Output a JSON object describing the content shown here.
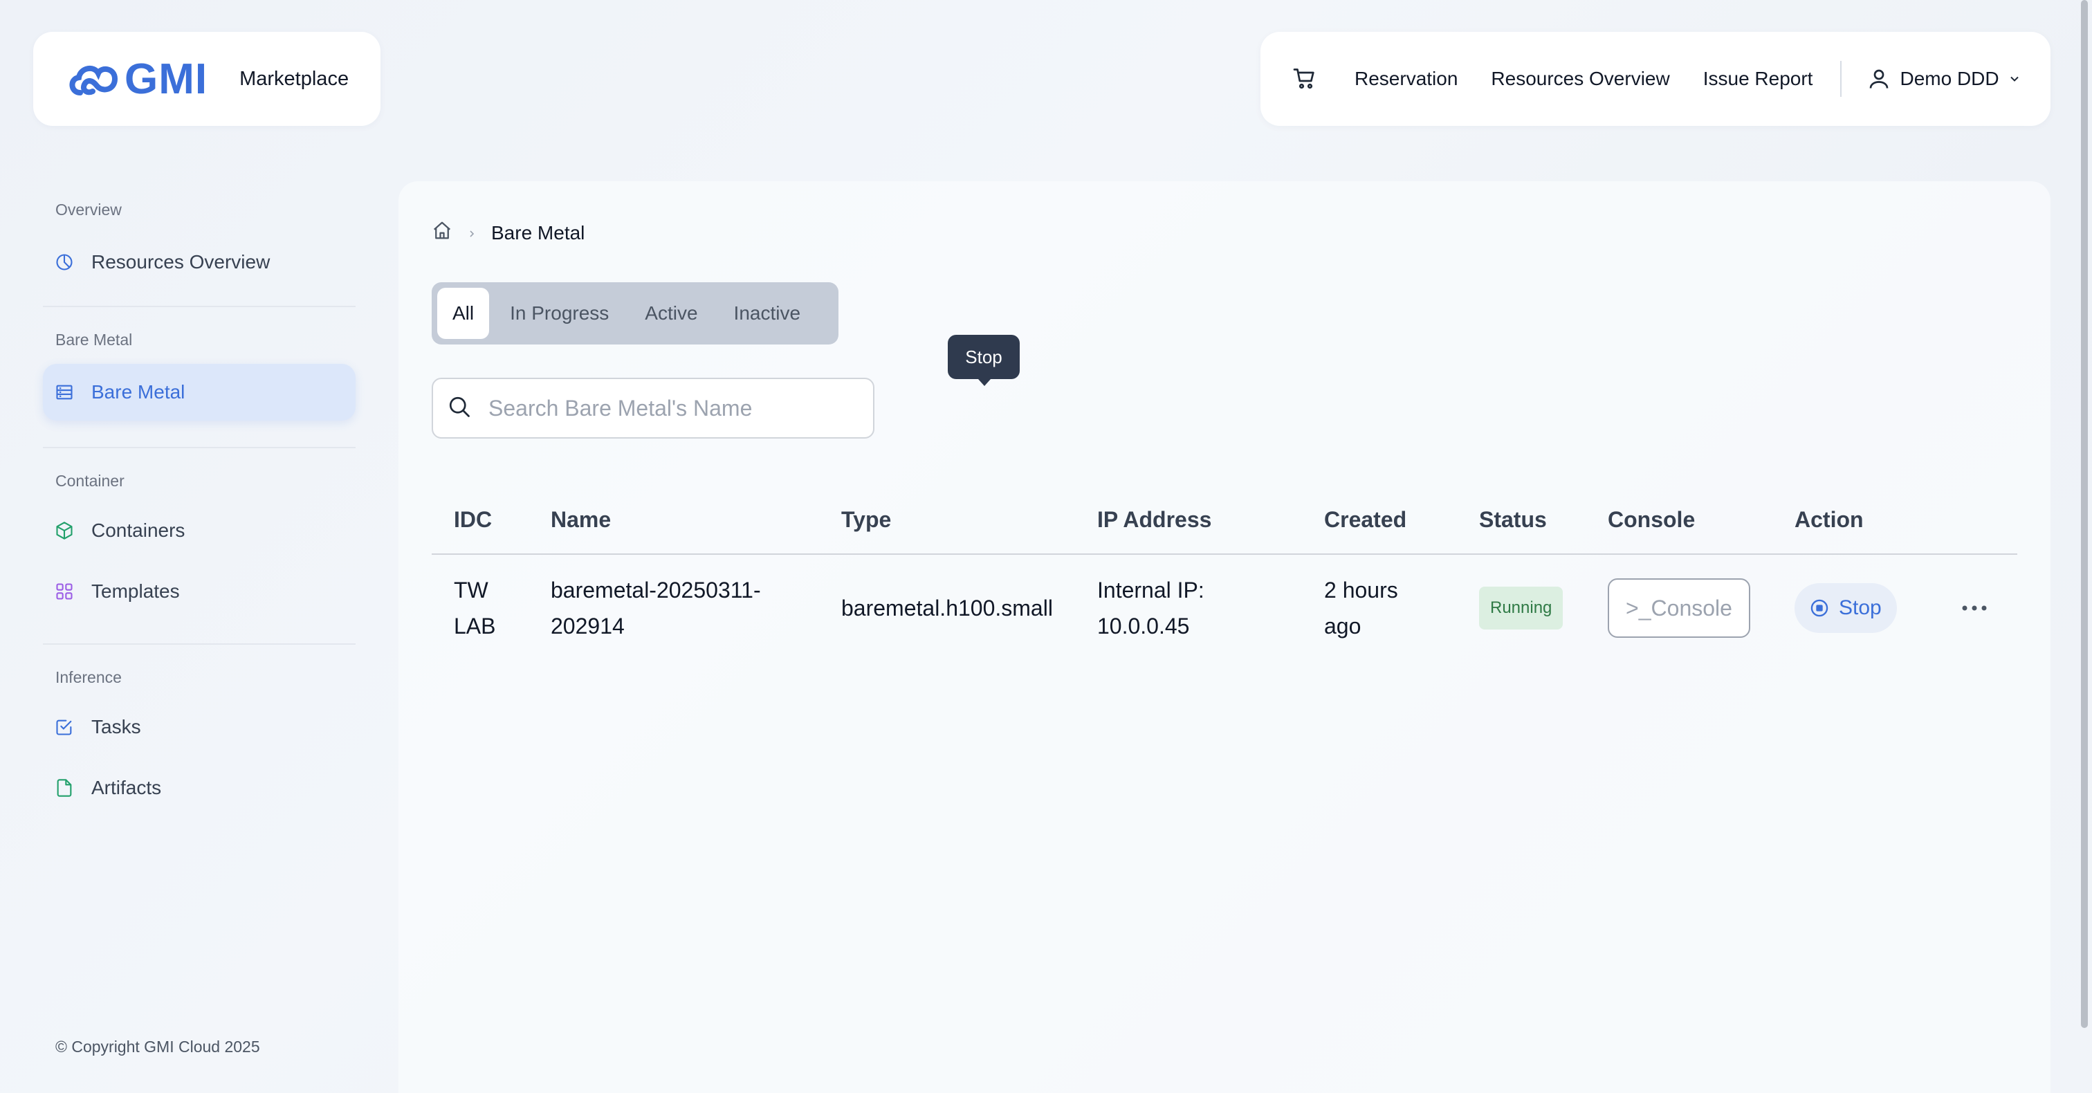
{
  "brand": {
    "name": "GMI",
    "marketplace_label": "Marketplace"
  },
  "nav": {
    "links": [
      "Reservation",
      "Resources Overview",
      "Issue Report"
    ],
    "user_name": "Demo DDD"
  },
  "sidebar": {
    "sections": [
      {
        "title": "Overview",
        "items": [
          {
            "label": "Resources Overview",
            "icon": "pie-chart-icon"
          }
        ]
      },
      {
        "title": "Bare Metal",
        "items": [
          {
            "label": "Bare Metal",
            "icon": "server-icon",
            "active": true
          }
        ]
      },
      {
        "title": "Container",
        "items": [
          {
            "label": "Containers",
            "icon": "cube-icon"
          },
          {
            "label": "Templates",
            "icon": "grid-icon"
          }
        ]
      },
      {
        "title": "Inference",
        "items": [
          {
            "label": "Tasks",
            "icon": "checkbox-icon"
          },
          {
            "label": "Artifacts",
            "icon": "file-icon"
          }
        ]
      }
    ],
    "copyright": "© Copyright GMI Cloud 2025"
  },
  "breadcrumb": {
    "current": "Bare Metal"
  },
  "tabs": [
    "All",
    "In Progress",
    "Active",
    "Inactive"
  ],
  "search": {
    "placeholder": "Search Bare Metal's Name",
    "value": ""
  },
  "table": {
    "headers": [
      "IDC",
      "Name",
      "Type",
      "IP Address",
      "Created",
      "Status",
      "Console",
      "Action"
    ],
    "rows": [
      {
        "idc_line1": "TW",
        "idc_line2": "LAB",
        "name_line1": "baremetal-20250311-",
        "name_line2": "202914",
        "type": "baremetal.h100.small",
        "ip_line1": "Internal IP:",
        "ip_line2": "10.0.0.45",
        "created_line1": "2 hours",
        "created_line2": "ago",
        "status": "Running",
        "console_label": ">_Console",
        "action_label": "Stop"
      }
    ]
  },
  "tooltip": {
    "text": "Stop"
  },
  "colors": {
    "accent": "#3b6fd9",
    "status_running_bg": "#dcefe1",
    "status_running_text": "#2f7a45"
  }
}
